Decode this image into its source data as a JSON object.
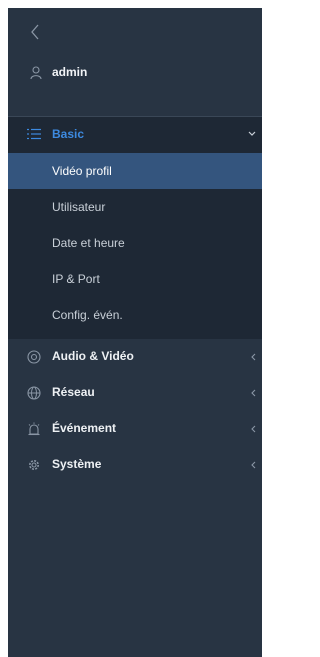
{
  "user": {
    "name": "admin"
  },
  "basic": {
    "label": "Basic",
    "items": [
      {
        "label": "Vidéo profil",
        "active": true
      },
      {
        "label": "Utilisateur",
        "active": false
      },
      {
        "label": "Date et heure",
        "active": false
      },
      {
        "label": "IP & Port",
        "active": false
      },
      {
        "label": "Config. évén.",
        "active": false
      }
    ]
  },
  "menu": [
    {
      "label": "Audio & Vidéo",
      "icon": "camera-icon"
    },
    {
      "label": "Réseau",
      "icon": "globe-icon"
    },
    {
      "label": "Événement",
      "icon": "alarm-icon"
    },
    {
      "label": "Système",
      "icon": "gear-icon"
    }
  ],
  "colors": {
    "sidebar_bg": "#283443",
    "group_bg": "#1e2835",
    "active_bg": "#34557e",
    "accent": "#3d8ae0"
  }
}
